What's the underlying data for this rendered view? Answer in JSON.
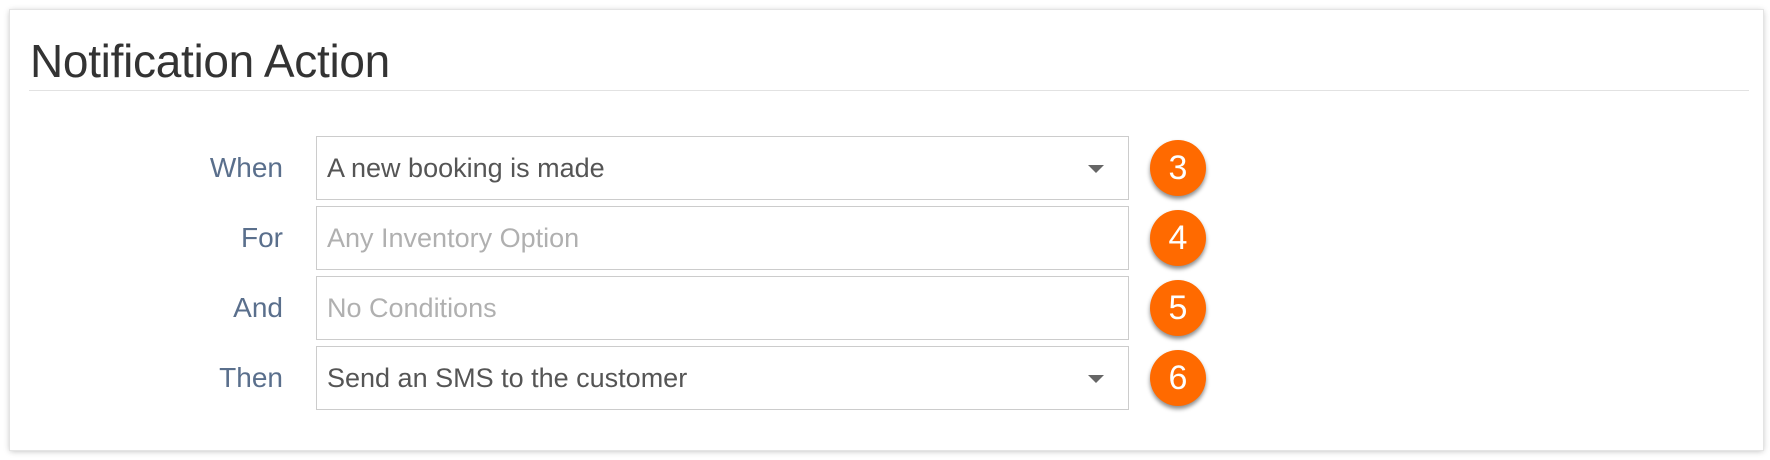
{
  "title": "Notification Action",
  "rows": [
    {
      "label": "When",
      "value": "A new booking is made",
      "badge": "3"
    },
    {
      "label": "For",
      "placeholder": "Any Inventory Option",
      "badge": "4"
    },
    {
      "label": "And",
      "placeholder": "No Conditions",
      "badge": "5"
    },
    {
      "label": "Then",
      "value": "Send an SMS to the customer",
      "badge": "6"
    }
  ],
  "colors": {
    "label": "#5a6f8c",
    "badge": "#ff6a00",
    "placeholder": "#b0b0b0"
  },
  "icons": {
    "dropdown": "caret-down-icon"
  }
}
